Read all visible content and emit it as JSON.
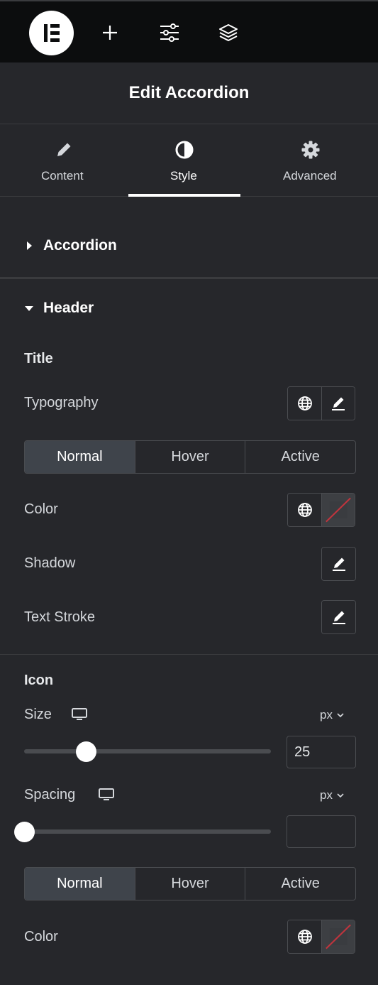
{
  "panel": {
    "title": "Edit Accordion"
  },
  "tabs": [
    {
      "label": "Content",
      "icon": "pencil-icon"
    },
    {
      "label": "Style",
      "icon": "contrast-icon",
      "active": true
    },
    {
      "label": "Advanced",
      "icon": "gear-icon"
    }
  ],
  "sections": {
    "accordion": {
      "label": "Accordion",
      "expanded": false
    },
    "header": {
      "label": "Header",
      "expanded": true
    }
  },
  "title_group": {
    "heading": "Title",
    "typography_label": "Typography",
    "states": [
      "Normal",
      "Hover",
      "Active"
    ],
    "active_state": "Normal",
    "color_label": "Color",
    "shadow_label": "Shadow",
    "text_stroke_label": "Text Stroke"
  },
  "icon_group": {
    "heading": "Icon",
    "size": {
      "label": "Size",
      "unit": "px",
      "value": "25",
      "slider_fraction": 0.25
    },
    "spacing": {
      "label": "Spacing",
      "unit": "px",
      "value": "",
      "slider_fraction": 0
    },
    "states": [
      "Normal",
      "Hover",
      "Active"
    ],
    "active_state": "Normal",
    "color_label": "Color"
  },
  "colors": {
    "topbar": "#0c0d0e",
    "panel_bg": "#26272b",
    "active_segment": "#3f444b",
    "empty_color_slash": "#c2343d"
  }
}
